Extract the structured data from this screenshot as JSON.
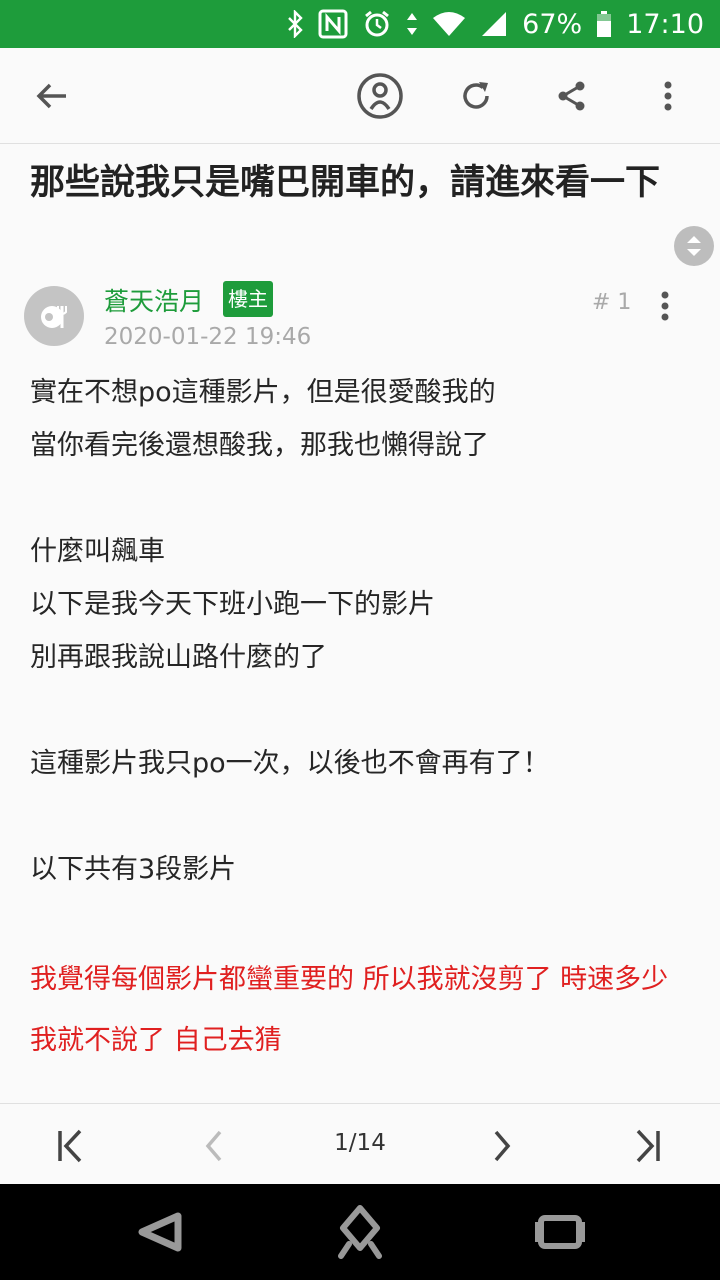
{
  "status_bar": {
    "battery": "67%",
    "time": "17:10",
    "icons": [
      "bluetooth-icon",
      "nfc-icon",
      "alarm-icon",
      "wifi-icon",
      "cell-signal-icon",
      "battery-icon"
    ]
  },
  "app_bar": {
    "icons": [
      "back-arrow-icon",
      "account-icon",
      "refresh-icon",
      "share-icon",
      "more-vert-icon"
    ]
  },
  "post": {
    "title": "那些說我只是嘴巴開車的，請進來看一下",
    "author": "蒼天浩月",
    "op_badge": "樓主",
    "date": "2020-01-22 19:46",
    "floor": "# 1",
    "body_lines": [
      "實在不想po這種影片，但是很愛酸我的",
      "當你看完後還想酸我，那我也懶得說了",
      "",
      "什麼叫飆車",
      "以下是我今天下班小跑一下的影片",
      "別再跟我說山路什麼的了",
      "",
      "這種影片我只po一次，以後也不會再有了！",
      "",
      "以下共有3段影片",
      ""
    ],
    "highlight_text": "我覺得每個影片都蠻重要的 所以我就沒剪了 時速多少我就不說了 自己去猜"
  },
  "pager": {
    "current_page": 1,
    "total_pages": 14,
    "indicator": "1/14"
  },
  "colors": {
    "brand_green": "#1e9c3b",
    "highlight_red": "#e02020",
    "meta_gray": "#a9a9a9"
  }
}
